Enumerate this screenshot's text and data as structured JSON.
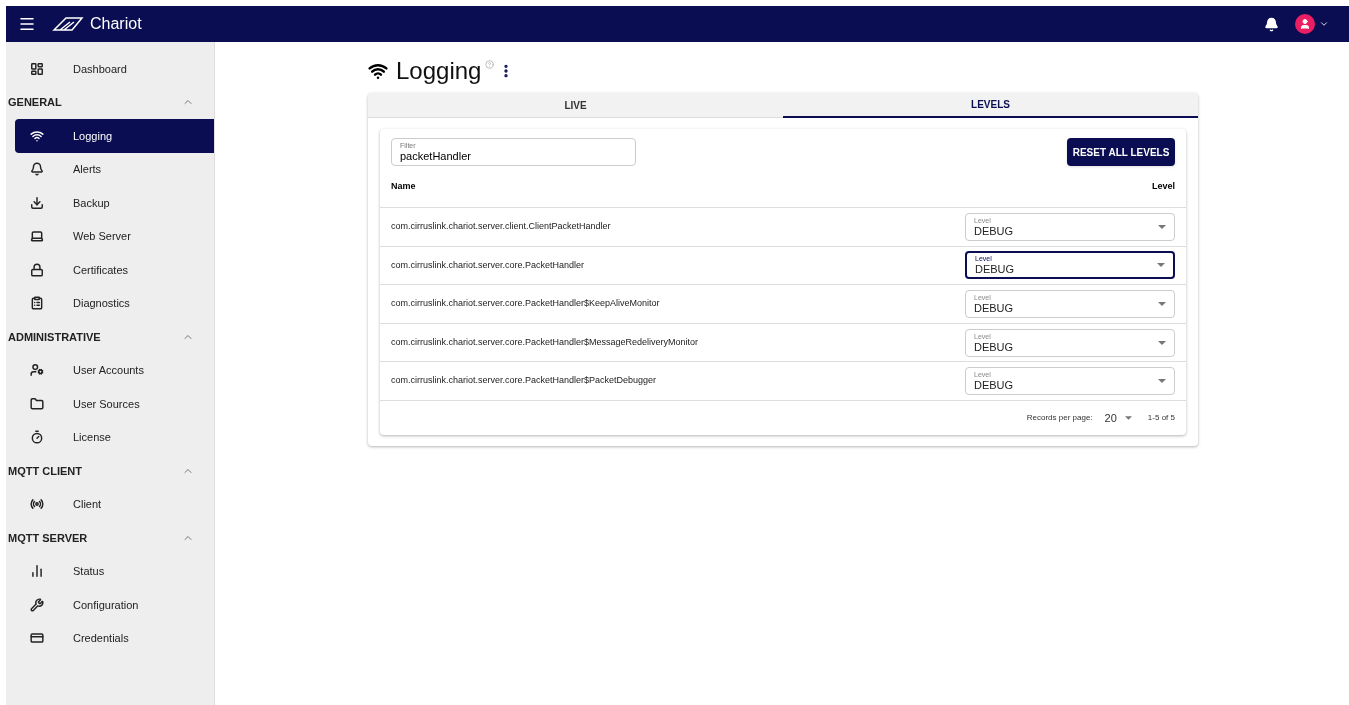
{
  "app_bar": {
    "brand": "Chariot"
  },
  "sidebar": [
    {
      "kind": "item",
      "label": "Dashboard",
      "selected": false
    },
    {
      "kind": "section",
      "label": "GENERAL",
      "expanded": true
    },
    {
      "kind": "item",
      "label": "Logging",
      "selected": true
    },
    {
      "kind": "item",
      "label": "Alerts",
      "selected": false
    },
    {
      "kind": "item",
      "label": "Backup",
      "selected": false
    },
    {
      "kind": "item",
      "label": "Web Server",
      "selected": false
    },
    {
      "kind": "item",
      "label": "Certificates",
      "selected": false
    },
    {
      "kind": "item",
      "label": "Diagnostics",
      "selected": false
    },
    {
      "kind": "section",
      "label": "ADMINISTRATIVE",
      "expanded": true
    },
    {
      "kind": "item",
      "label": "User Accounts",
      "selected": false
    },
    {
      "kind": "item",
      "label": "User Sources",
      "selected": false
    },
    {
      "kind": "item",
      "label": "License",
      "selected": false
    },
    {
      "kind": "section",
      "label": "MQTT CLIENT",
      "expanded": true
    },
    {
      "kind": "item",
      "label": "Client",
      "selected": false
    },
    {
      "kind": "section",
      "label": "MQTT SERVER",
      "expanded": true
    },
    {
      "kind": "item",
      "label": "Status",
      "selected": false
    },
    {
      "kind": "item",
      "label": "Configuration",
      "selected": false
    },
    {
      "kind": "item",
      "label": "Credentials",
      "selected": false
    }
  ],
  "page": {
    "title": "Logging"
  },
  "tabs": [
    {
      "label": "LIVE",
      "selected": false
    },
    {
      "label": "LEVELS",
      "selected": true
    }
  ],
  "filter": {
    "label": "Filter",
    "value": "packetHandler"
  },
  "reset_button": "RESET ALL LEVELS",
  "table": {
    "columns": [
      "Name",
      "Level"
    ],
    "rows": [
      {
        "name": "com.cirruslink.chariot.server.client.ClientPacketHandler",
        "field_label": "Level",
        "level_value": "DEBUG",
        "focused": false
      },
      {
        "name": "com.cirruslink.chariot.server.core.PacketHandler",
        "field_label": "Level",
        "level_value": "DEBUG",
        "focused": true
      },
      {
        "name": "com.cirruslink.chariot.server.core.PacketHandler$KeepAliveMonitor",
        "field_label": "Level",
        "level_value": "DEBUG",
        "focused": false
      },
      {
        "name": "com.cirruslink.chariot.server.core.PacketHandler$MessageRedeliveryMonitor",
        "field_label": "Level",
        "level_value": "DEBUG",
        "focused": false
      },
      {
        "name": "com.cirruslink.chariot.server.core.PacketHandler$PacketDebugger",
        "field_label": "Level",
        "level_value": "DEBUG",
        "focused": false
      }
    ]
  },
  "pagination": {
    "label": "Records per page:",
    "per_page": "20",
    "range": "1-5 of 5"
  }
}
